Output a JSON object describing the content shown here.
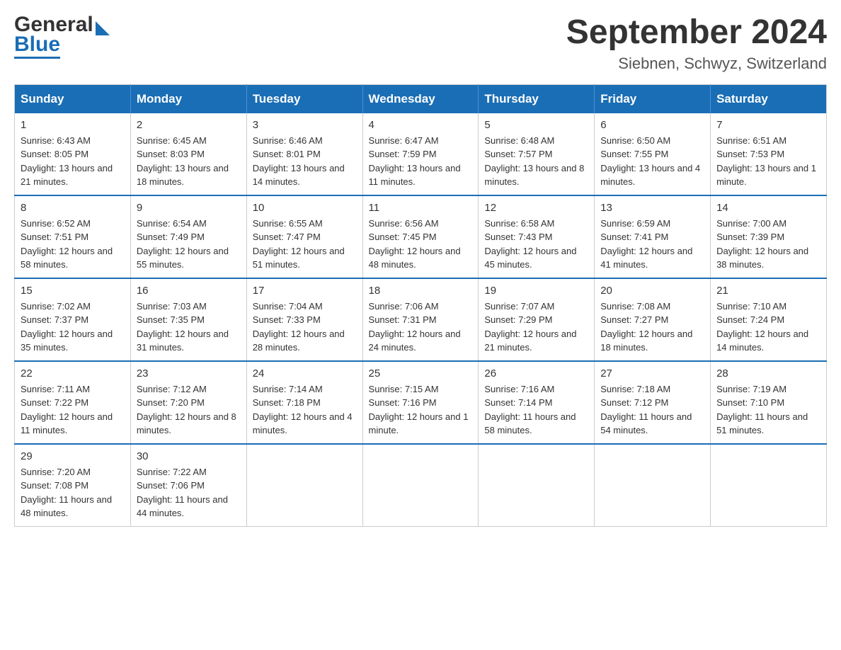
{
  "logo": {
    "general": "General",
    "blue": "Blue"
  },
  "title": {
    "month_year": "September 2024",
    "location": "Siebnen, Schwyz, Switzerland"
  },
  "headers": [
    "Sunday",
    "Monday",
    "Tuesday",
    "Wednesday",
    "Thursday",
    "Friday",
    "Saturday"
  ],
  "weeks": [
    [
      {
        "day": "1",
        "sunrise": "Sunrise: 6:43 AM",
        "sunset": "Sunset: 8:05 PM",
        "daylight": "Daylight: 13 hours and 21 minutes."
      },
      {
        "day": "2",
        "sunrise": "Sunrise: 6:45 AM",
        "sunset": "Sunset: 8:03 PM",
        "daylight": "Daylight: 13 hours and 18 minutes."
      },
      {
        "day": "3",
        "sunrise": "Sunrise: 6:46 AM",
        "sunset": "Sunset: 8:01 PM",
        "daylight": "Daylight: 13 hours and 14 minutes."
      },
      {
        "day": "4",
        "sunrise": "Sunrise: 6:47 AM",
        "sunset": "Sunset: 7:59 PM",
        "daylight": "Daylight: 13 hours and 11 minutes."
      },
      {
        "day": "5",
        "sunrise": "Sunrise: 6:48 AM",
        "sunset": "Sunset: 7:57 PM",
        "daylight": "Daylight: 13 hours and 8 minutes."
      },
      {
        "day": "6",
        "sunrise": "Sunrise: 6:50 AM",
        "sunset": "Sunset: 7:55 PM",
        "daylight": "Daylight: 13 hours and 4 minutes."
      },
      {
        "day": "7",
        "sunrise": "Sunrise: 6:51 AM",
        "sunset": "Sunset: 7:53 PM",
        "daylight": "Daylight: 13 hours and 1 minute."
      }
    ],
    [
      {
        "day": "8",
        "sunrise": "Sunrise: 6:52 AM",
        "sunset": "Sunset: 7:51 PM",
        "daylight": "Daylight: 12 hours and 58 minutes."
      },
      {
        "day": "9",
        "sunrise": "Sunrise: 6:54 AM",
        "sunset": "Sunset: 7:49 PM",
        "daylight": "Daylight: 12 hours and 55 minutes."
      },
      {
        "day": "10",
        "sunrise": "Sunrise: 6:55 AM",
        "sunset": "Sunset: 7:47 PM",
        "daylight": "Daylight: 12 hours and 51 minutes."
      },
      {
        "day": "11",
        "sunrise": "Sunrise: 6:56 AM",
        "sunset": "Sunset: 7:45 PM",
        "daylight": "Daylight: 12 hours and 48 minutes."
      },
      {
        "day": "12",
        "sunrise": "Sunrise: 6:58 AM",
        "sunset": "Sunset: 7:43 PM",
        "daylight": "Daylight: 12 hours and 45 minutes."
      },
      {
        "day": "13",
        "sunrise": "Sunrise: 6:59 AM",
        "sunset": "Sunset: 7:41 PM",
        "daylight": "Daylight: 12 hours and 41 minutes."
      },
      {
        "day": "14",
        "sunrise": "Sunrise: 7:00 AM",
        "sunset": "Sunset: 7:39 PM",
        "daylight": "Daylight: 12 hours and 38 minutes."
      }
    ],
    [
      {
        "day": "15",
        "sunrise": "Sunrise: 7:02 AM",
        "sunset": "Sunset: 7:37 PM",
        "daylight": "Daylight: 12 hours and 35 minutes."
      },
      {
        "day": "16",
        "sunrise": "Sunrise: 7:03 AM",
        "sunset": "Sunset: 7:35 PM",
        "daylight": "Daylight: 12 hours and 31 minutes."
      },
      {
        "day": "17",
        "sunrise": "Sunrise: 7:04 AM",
        "sunset": "Sunset: 7:33 PM",
        "daylight": "Daylight: 12 hours and 28 minutes."
      },
      {
        "day": "18",
        "sunrise": "Sunrise: 7:06 AM",
        "sunset": "Sunset: 7:31 PM",
        "daylight": "Daylight: 12 hours and 24 minutes."
      },
      {
        "day": "19",
        "sunrise": "Sunrise: 7:07 AM",
        "sunset": "Sunset: 7:29 PM",
        "daylight": "Daylight: 12 hours and 21 minutes."
      },
      {
        "day": "20",
        "sunrise": "Sunrise: 7:08 AM",
        "sunset": "Sunset: 7:27 PM",
        "daylight": "Daylight: 12 hours and 18 minutes."
      },
      {
        "day": "21",
        "sunrise": "Sunrise: 7:10 AM",
        "sunset": "Sunset: 7:24 PM",
        "daylight": "Daylight: 12 hours and 14 minutes."
      }
    ],
    [
      {
        "day": "22",
        "sunrise": "Sunrise: 7:11 AM",
        "sunset": "Sunset: 7:22 PM",
        "daylight": "Daylight: 12 hours and 11 minutes."
      },
      {
        "day": "23",
        "sunrise": "Sunrise: 7:12 AM",
        "sunset": "Sunset: 7:20 PM",
        "daylight": "Daylight: 12 hours and 8 minutes."
      },
      {
        "day": "24",
        "sunrise": "Sunrise: 7:14 AM",
        "sunset": "Sunset: 7:18 PM",
        "daylight": "Daylight: 12 hours and 4 minutes."
      },
      {
        "day": "25",
        "sunrise": "Sunrise: 7:15 AM",
        "sunset": "Sunset: 7:16 PM",
        "daylight": "Daylight: 12 hours and 1 minute."
      },
      {
        "day": "26",
        "sunrise": "Sunrise: 7:16 AM",
        "sunset": "Sunset: 7:14 PM",
        "daylight": "Daylight: 11 hours and 58 minutes."
      },
      {
        "day": "27",
        "sunrise": "Sunrise: 7:18 AM",
        "sunset": "Sunset: 7:12 PM",
        "daylight": "Daylight: 11 hours and 54 minutes."
      },
      {
        "day": "28",
        "sunrise": "Sunrise: 7:19 AM",
        "sunset": "Sunset: 7:10 PM",
        "daylight": "Daylight: 11 hours and 51 minutes."
      }
    ],
    [
      {
        "day": "29",
        "sunrise": "Sunrise: 7:20 AM",
        "sunset": "Sunset: 7:08 PM",
        "daylight": "Daylight: 11 hours and 48 minutes."
      },
      {
        "day": "30",
        "sunrise": "Sunrise: 7:22 AM",
        "sunset": "Sunset: 7:06 PM",
        "daylight": "Daylight: 11 hours and 44 minutes."
      },
      {
        "day": "",
        "sunrise": "",
        "sunset": "",
        "daylight": ""
      },
      {
        "day": "",
        "sunrise": "",
        "sunset": "",
        "daylight": ""
      },
      {
        "day": "",
        "sunrise": "",
        "sunset": "",
        "daylight": ""
      },
      {
        "day": "",
        "sunrise": "",
        "sunset": "",
        "daylight": ""
      },
      {
        "day": "",
        "sunrise": "",
        "sunset": "",
        "daylight": ""
      }
    ]
  ]
}
